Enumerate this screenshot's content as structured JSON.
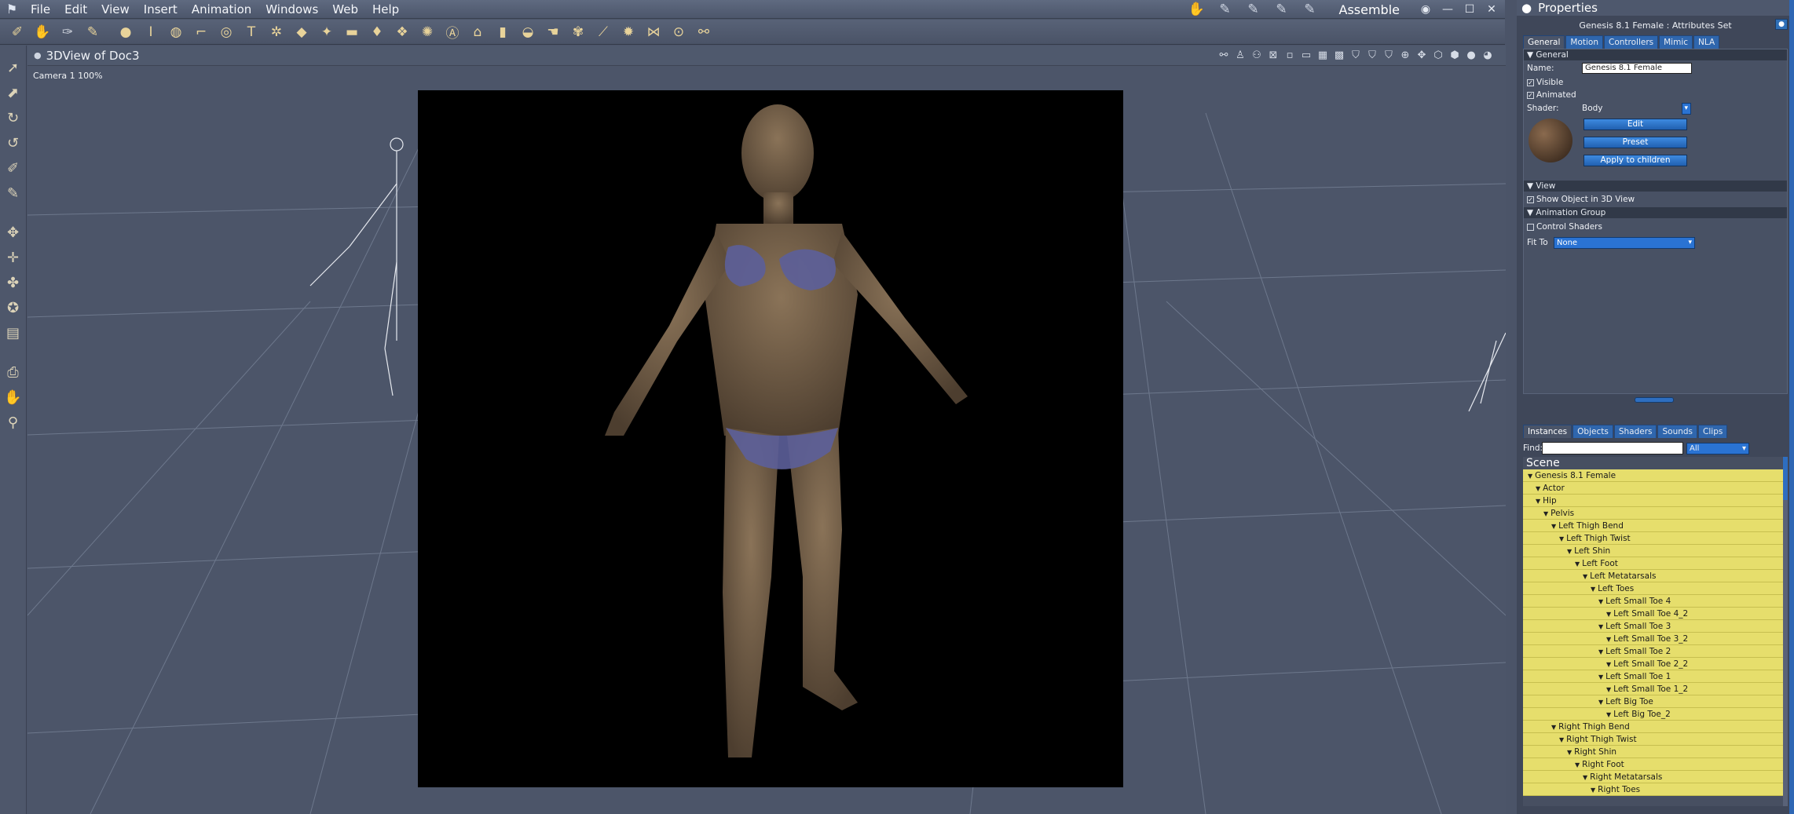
{
  "menubar": {
    "items": [
      "File",
      "Edit",
      "View",
      "Insert",
      "Animation",
      "Windows",
      "Web",
      "Help"
    ],
    "room": "Assemble"
  },
  "viewport": {
    "title": "3DView of Doc3",
    "camera_label": "Camera 1 100%"
  },
  "properties": {
    "title": "Properties",
    "subtitle": "Genesis 8.1 Female : Attributes Set",
    "tabs": [
      "General",
      "Motion",
      "Controllers",
      "Mimic",
      "NLA"
    ],
    "general": {
      "section": "General",
      "name_label": "Name:",
      "name_value": "Genesis 8.1 Female",
      "visible_label": "Visible",
      "animated_label": "Animated",
      "shader_label": "Shader:",
      "shader_value": "Body",
      "edit_btn": "Edit",
      "preset_btn": "Preset",
      "apply_btn": "Apply to children"
    },
    "view": {
      "section": "View",
      "show_label": "Show Object in 3D View"
    },
    "animgroup": {
      "section": "Animation Group",
      "control_label": "Control Shaders",
      "fit_label": "Fit To",
      "fit_value": "None"
    }
  },
  "scene": {
    "tabs": [
      "Instances",
      "Objects",
      "Shaders",
      "Sounds",
      "Clips"
    ],
    "find_label": "Find:",
    "filter_value": "All",
    "header": "Scene",
    "tree": [
      {
        "label": "Genesis 8.1 Female",
        "depth": 0
      },
      {
        "label": "Actor",
        "depth": 1
      },
      {
        "label": "Hip",
        "depth": 1
      },
      {
        "label": "Pelvis",
        "depth": 2
      },
      {
        "label": "Left Thigh Bend",
        "depth": 3
      },
      {
        "label": "Left Thigh Twist",
        "depth": 4
      },
      {
        "label": "Left Shin",
        "depth": 5
      },
      {
        "label": "Left Foot",
        "depth": 6
      },
      {
        "label": "Left Metatarsals",
        "depth": 7
      },
      {
        "label": "Left Toes",
        "depth": 8
      },
      {
        "label": "Left Small Toe 4",
        "depth": 9
      },
      {
        "label": "Left Small Toe 4_2",
        "depth": 10
      },
      {
        "label": "Left Small Toe 3",
        "depth": 9
      },
      {
        "label": "Left Small Toe 3_2",
        "depth": 10
      },
      {
        "label": "Left Small Toe 2",
        "depth": 9
      },
      {
        "label": "Left Small Toe 2_2",
        "depth": 10
      },
      {
        "label": "Left Small Toe 1",
        "depth": 9
      },
      {
        "label": "Left Small Toe 1_2",
        "depth": 10
      },
      {
        "label": "Left Big Toe",
        "depth": 9
      },
      {
        "label": "Left Big Toe_2",
        "depth": 10
      },
      {
        "label": "Right Thigh Bend",
        "depth": 3
      },
      {
        "label": "Right Thigh Twist",
        "depth": 4
      },
      {
        "label": "Right Shin",
        "depth": 5
      },
      {
        "label": "Right Foot",
        "depth": 6
      },
      {
        "label": "Right Metatarsals",
        "depth": 7
      },
      {
        "label": "Right Toes",
        "depth": 8
      }
    ]
  },
  "colors": {
    "tree_node": "#e6de6c",
    "accent_blue": "#2a73d3",
    "render_bg": "#000000"
  }
}
